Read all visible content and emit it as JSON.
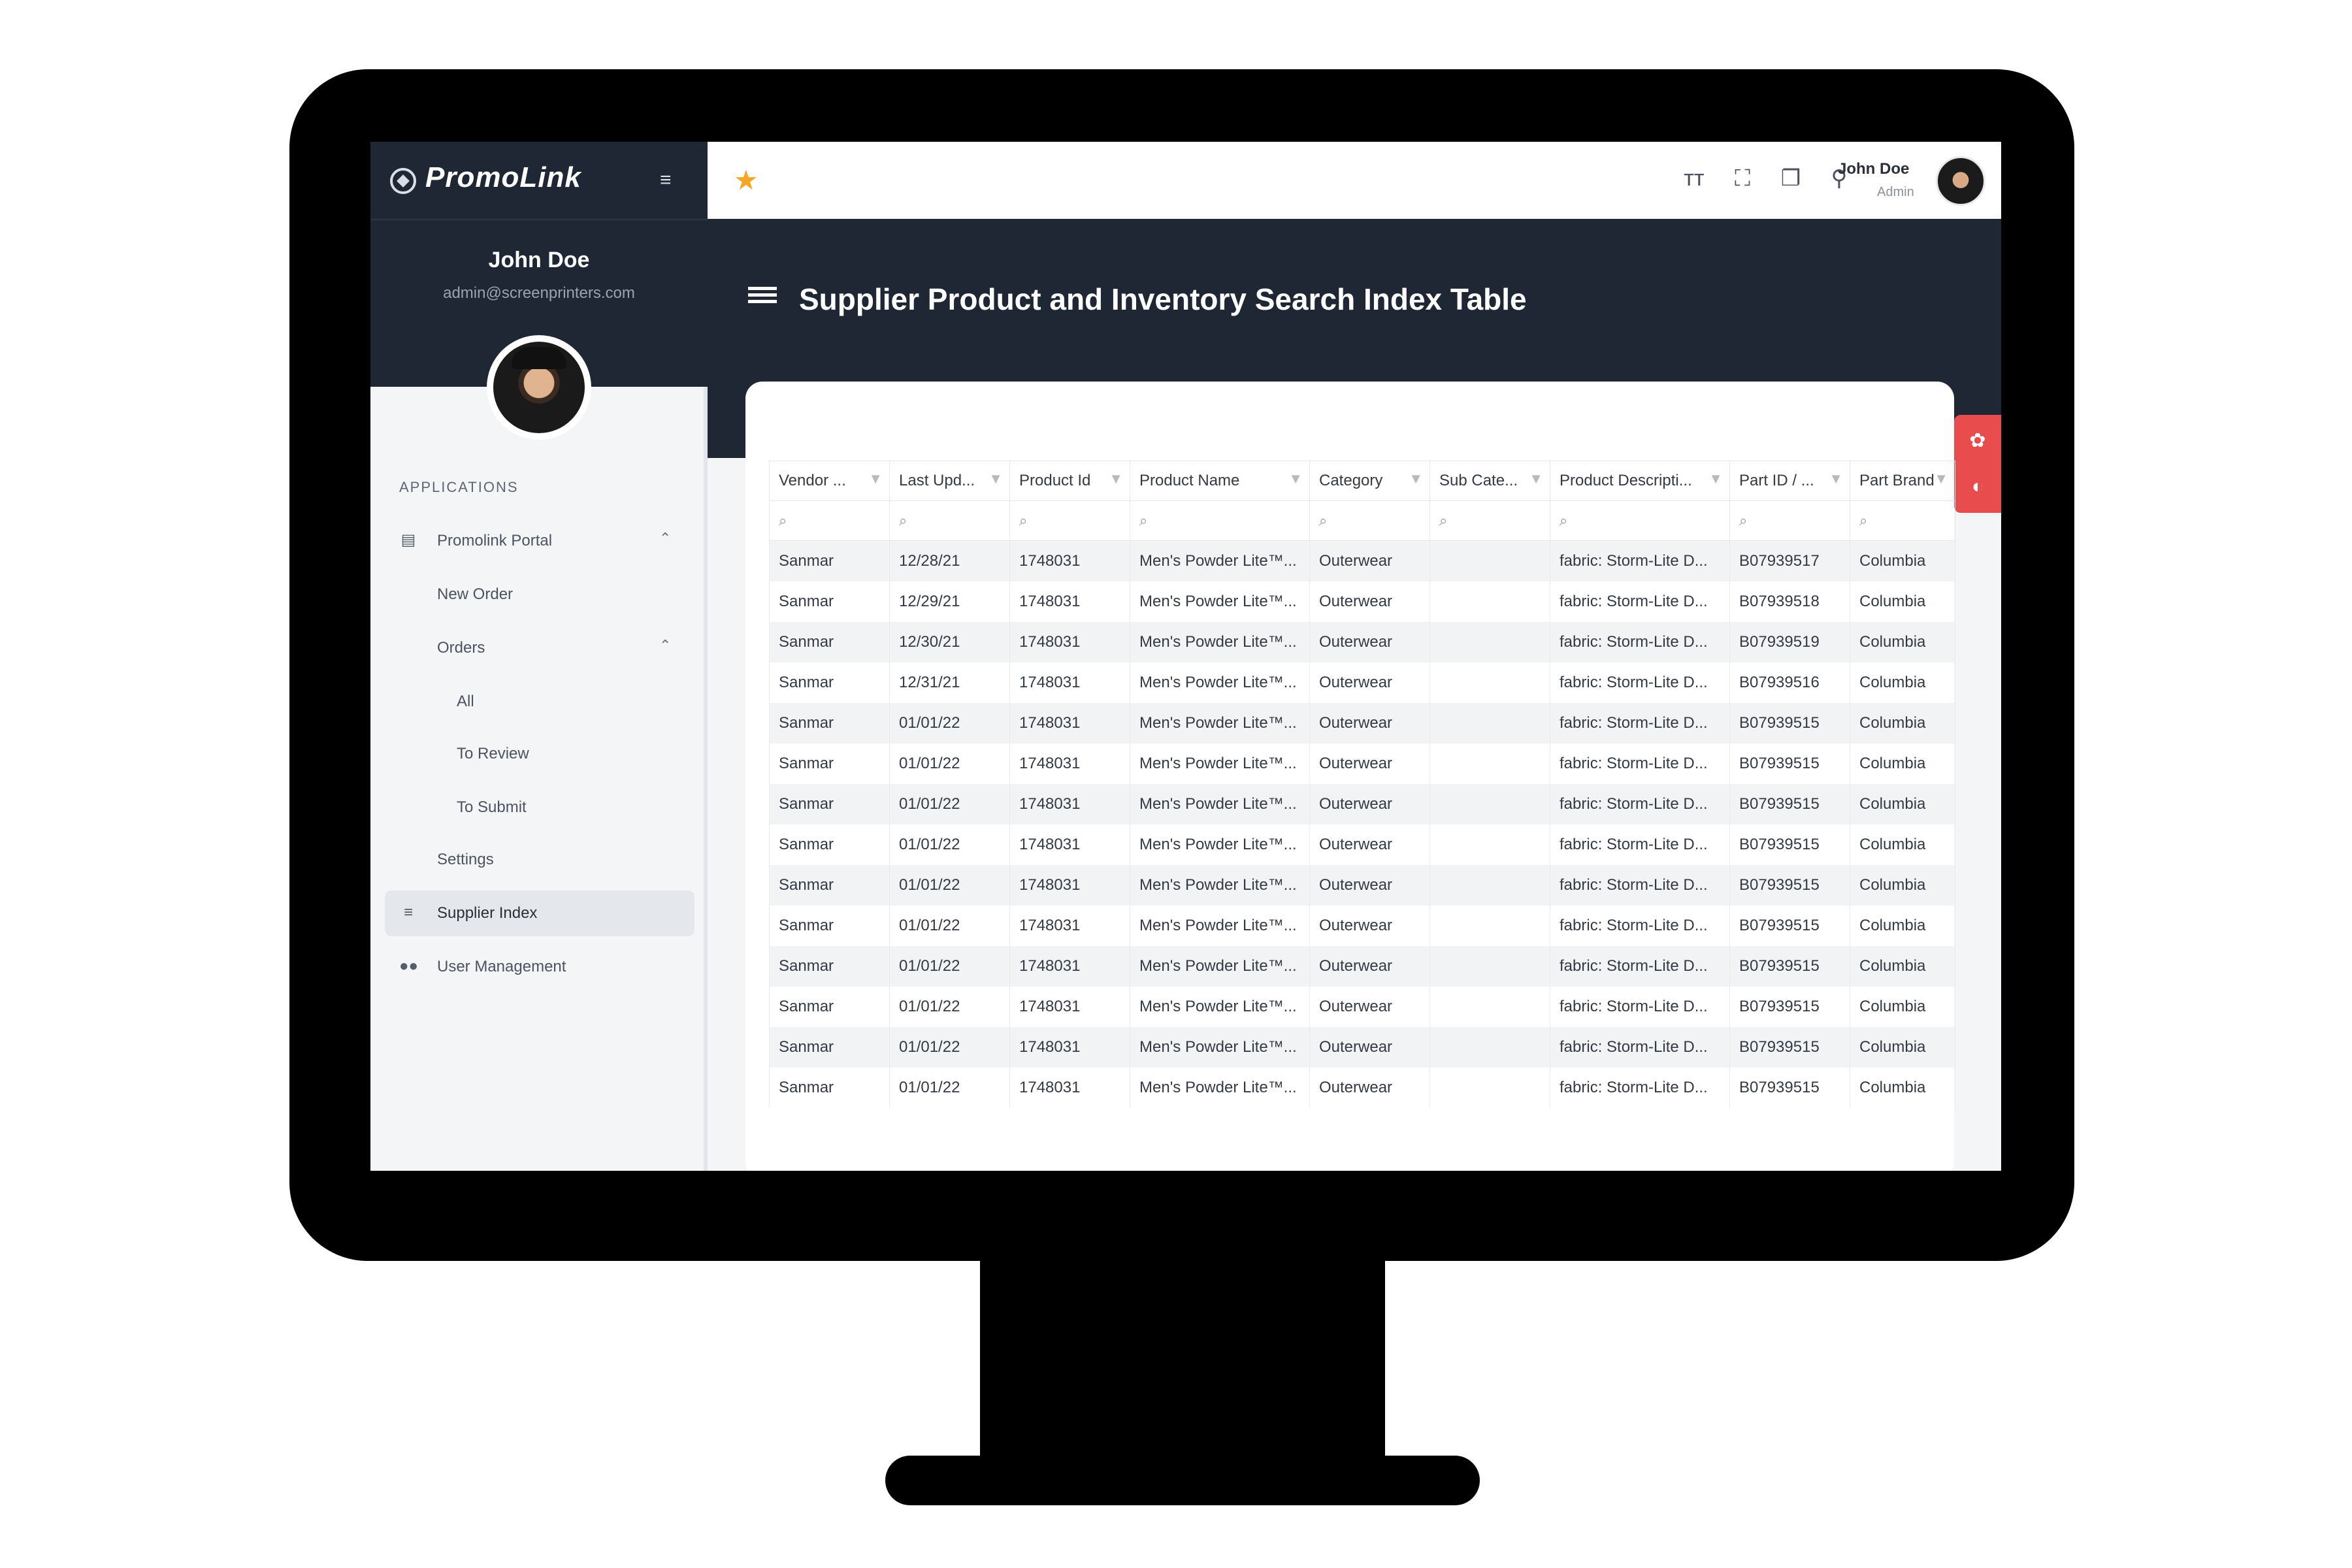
{
  "brand": {
    "logo_text": "PromoLink"
  },
  "sidebar": {
    "user_name": "John Doe",
    "user_email": "admin@screenprinters.com",
    "section_label": "APPLICATIONS",
    "items": [
      {
        "label": "Promolink Portal",
        "icon": "document-list-icon"
      },
      {
        "label": "New Order"
      },
      {
        "label": "Orders"
      },
      {
        "label": "All"
      },
      {
        "label": "To Review"
      },
      {
        "label": "To Submit"
      },
      {
        "label": "Settings"
      },
      {
        "label": "Supplier Index",
        "icon": "list-icon"
      },
      {
        "label": "User Management",
        "icon": "users-icon"
      }
    ]
  },
  "topbar": {
    "user_name": "John Doe",
    "user_role": "Admin",
    "icons": [
      "star-icon",
      "font-size-icon",
      "fullscreen-icon",
      "copy-icon",
      "bell-icon"
    ]
  },
  "page": {
    "title": "Supplier Product and Inventory Search Index Table"
  },
  "table": {
    "columns": [
      "Vendor ...",
      "Last Upd...",
      "Product Id",
      "Product Name",
      "Category",
      "Sub Cate...",
      "Product Descripti...",
      "Part ID / ...",
      "Part Brand"
    ],
    "rows": [
      [
        "Sanmar",
        "12/28/21",
        "1748031",
        "Men's Powder Lite™...",
        "Outerwear",
        "",
        "fabric: Storm-Lite D...",
        "B07939517",
        "Columbia"
      ],
      [
        "Sanmar",
        "12/29/21",
        "1748031",
        "Men's Powder Lite™...",
        "Outerwear",
        "",
        "fabric: Storm-Lite D...",
        "B07939518",
        "Columbia"
      ],
      [
        "Sanmar",
        "12/30/21",
        "1748031",
        "Men's Powder Lite™...",
        "Outerwear",
        "",
        "fabric: Storm-Lite D...",
        "B07939519",
        "Columbia"
      ],
      [
        "Sanmar",
        "12/31/21",
        "1748031",
        "Men's Powder Lite™...",
        "Outerwear",
        "",
        "fabric: Storm-Lite D...",
        "B07939516",
        "Columbia"
      ],
      [
        "Sanmar",
        "01/01/22",
        "1748031",
        "Men's Powder Lite™...",
        "Outerwear",
        "",
        "fabric: Storm-Lite D...",
        "B07939515",
        "Columbia"
      ],
      [
        "Sanmar",
        "01/01/22",
        "1748031",
        "Men's Powder Lite™...",
        "Outerwear",
        "",
        "fabric: Storm-Lite D...",
        "B07939515",
        "Columbia"
      ],
      [
        "Sanmar",
        "01/01/22",
        "1748031",
        "Men's Powder Lite™...",
        "Outerwear",
        "",
        "fabric: Storm-Lite D...",
        "B07939515",
        "Columbia"
      ],
      [
        "Sanmar",
        "01/01/22",
        "1748031",
        "Men's Powder Lite™...",
        "Outerwear",
        "",
        "fabric: Storm-Lite D...",
        "B07939515",
        "Columbia"
      ],
      [
        "Sanmar",
        "01/01/22",
        "1748031",
        "Men's Powder Lite™...",
        "Outerwear",
        "",
        "fabric: Storm-Lite D...",
        "B07939515",
        "Columbia"
      ],
      [
        "Sanmar",
        "01/01/22",
        "1748031",
        "Men's Powder Lite™...",
        "Outerwear",
        "",
        "fabric: Storm-Lite D...",
        "B07939515",
        "Columbia"
      ],
      [
        "Sanmar",
        "01/01/22",
        "1748031",
        "Men's Powder Lite™...",
        "Outerwear",
        "",
        "fabric: Storm-Lite D...",
        "B07939515",
        "Columbia"
      ],
      [
        "Sanmar",
        "01/01/22",
        "1748031",
        "Men's Powder Lite™...",
        "Outerwear",
        "",
        "fabric: Storm-Lite D...",
        "B07939515",
        "Columbia"
      ],
      [
        "Sanmar",
        "01/01/22",
        "1748031",
        "Men's Powder Lite™...",
        "Outerwear",
        "",
        "fabric: Storm-Lite D...",
        "B07939515",
        "Columbia"
      ],
      [
        "Sanmar",
        "01/01/22",
        "1748031",
        "Men's Powder Lite™...",
        "Outerwear",
        "",
        "fabric: Storm-Lite D...",
        "B07939515",
        "Columbia"
      ]
    ]
  },
  "colors": {
    "dark": "#1f2735",
    "accent_star": "#f5a623",
    "side_tab": "#e84c4c"
  }
}
